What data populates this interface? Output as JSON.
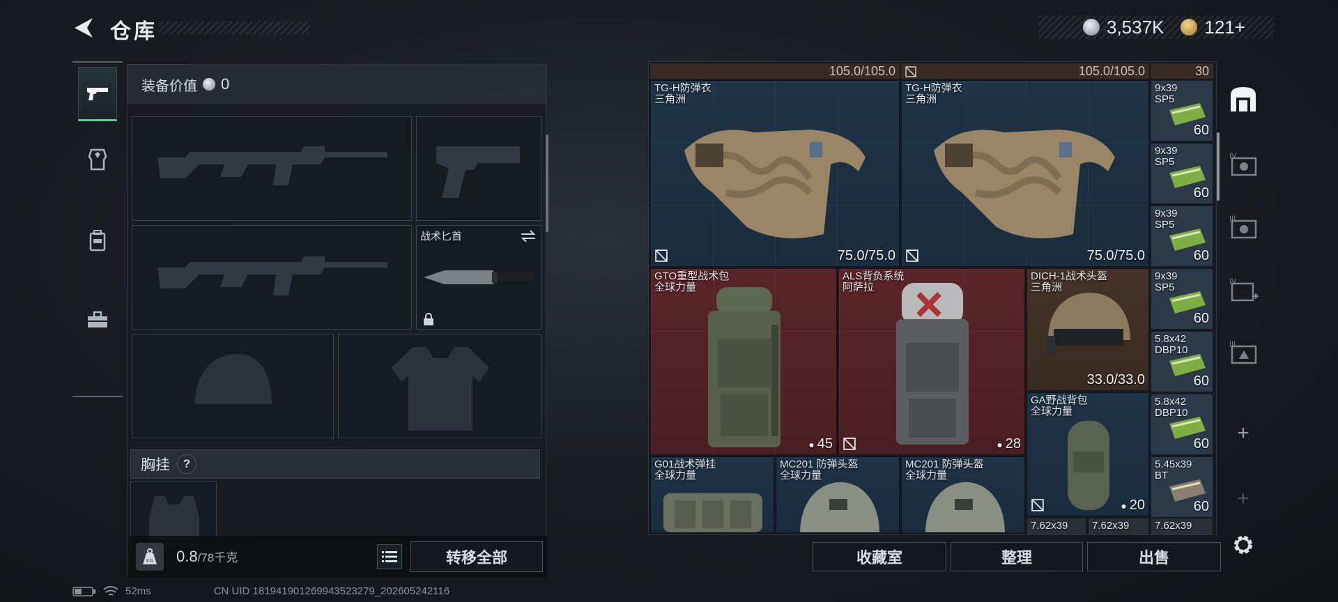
{
  "header": {
    "title": "仓库"
  },
  "currency": {
    "coins": "3,537K",
    "tokens": "121+"
  },
  "equipment": {
    "value_label": "装备价值",
    "value": "0",
    "knife_label": "战术匕首",
    "chest_label": "胸挂",
    "chest_help": "?",
    "weight_value": "0.8",
    "weight_unit": "/78千克",
    "weight_icon_text": "KG",
    "transfer_all": "转移全部"
  },
  "storage": {
    "top_labels": [
      "105.0/105.0",
      "105.0/105.0",
      "30"
    ],
    "items": [
      {
        "name": "TG-H防弹衣",
        "sub": "三角洲",
        "value": "75.0/75.0"
      },
      {
        "name": "TG-H防弹衣",
        "sub": "三角洲",
        "value": "75.0/75.0"
      },
      {
        "name": "GTO重型战术包",
        "sub": "全球力量",
        "value": "45"
      },
      {
        "name": "ALS背负系统",
        "sub": "阿萨拉",
        "value": "28"
      },
      {
        "name": "DICH-1战术头盔",
        "sub": "三角洲",
        "value": "33.0/33.0"
      },
      {
        "name": "GA野战背包",
        "sub": "全球力量",
        "value": "20"
      },
      {
        "name": "G01战术弹挂",
        "sub": "全球力量",
        "value": ""
      },
      {
        "name": "MC201 防弹头盔",
        "sub": "全球力量",
        "value": ""
      },
      {
        "name": "MC201 防弹头盔",
        "sub": "全球力量",
        "value": ""
      }
    ],
    "ammo": [
      {
        "name": "9x39",
        "sub": "SP5",
        "count": "60"
      },
      {
        "name": "9x39",
        "sub": "SP5",
        "count": "60"
      },
      {
        "name": "9x39",
        "sub": "SP5",
        "count": "60"
      },
      {
        "name": "9x39",
        "sub": "SP5",
        "count": "60"
      },
      {
        "name": "5.8x42",
        "sub": "DBP10",
        "count": "60"
      },
      {
        "name": "5.8x42",
        "sub": "DBP10",
        "count": "60"
      },
      {
        "name": "5.45x39",
        "sub": "BT",
        "count": "60"
      }
    ],
    "bottom_row": [
      "7.62x39",
      "7.62x39",
      "7.62x39"
    ]
  },
  "buttons": {
    "collection": "收藏室",
    "sort": "整理",
    "sell": "出售"
  },
  "sidebar": {
    "tier_labels": [
      "IV",
      "III",
      "IV",
      "III"
    ],
    "add": "+"
  },
  "status": {
    "ping": "52ms",
    "uid": "CN UID 181941901269943523279_202605242116"
  },
  "colors": {
    "accent": "#47e38a",
    "blue_cell": "#1f3346",
    "red_cell": "#5a2529",
    "brown_cell": "#453328",
    "ammo_green": "#8bc34a"
  }
}
